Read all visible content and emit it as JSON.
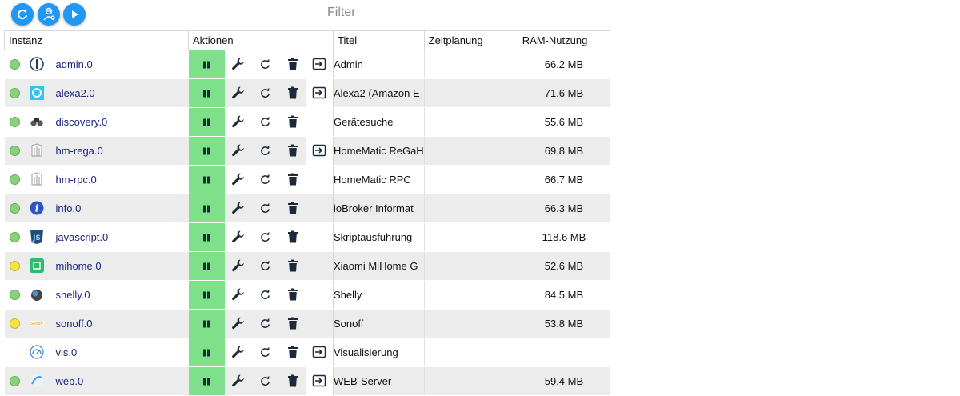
{
  "toolbar": {
    "filter_placeholder": "Filter",
    "button_color": "#2196f3"
  },
  "table": {
    "headers": {
      "instance": "Instanz",
      "actions": "Aktionen",
      "title": "Titel",
      "schedule": "Zeitplanung",
      "ram": "RAM-Nutzung"
    },
    "colors": {
      "status_green": "#8ad17a",
      "status_yellow": "#f5e24a",
      "pause_bg": "#7ee08a",
      "name_link": "#1a237e",
      "action_icon": "#1e2a3a"
    },
    "rows": [
      {
        "status": "green",
        "icon": "admin-icon",
        "name": "admin.0",
        "title": "Admin",
        "ram": "66.2 MB",
        "link": true
      },
      {
        "status": "green",
        "icon": "alexa-icon",
        "name": "alexa2.0",
        "title": "Alexa2 (Amazon E",
        "ram": "71.6 MB",
        "link": true
      },
      {
        "status": "green",
        "icon": "binoculars-icon",
        "name": "discovery.0",
        "title": "Gerätesuche",
        "ram": "55.6 MB",
        "link": false
      },
      {
        "status": "green",
        "icon": "homematic-icon",
        "name": "hm-rega.0",
        "title": "HomeMatic ReGaH",
        "ram": "69.8 MB",
        "link": true
      },
      {
        "status": "green",
        "icon": "homematic-icon",
        "name": "hm-rpc.0",
        "title": "HomeMatic RPC",
        "ram": "66.7 MB",
        "link": false
      },
      {
        "status": "green",
        "icon": "info-icon",
        "name": "info.0",
        "title": "ioBroker Informat",
        "ram": "66.3 MB",
        "link": false
      },
      {
        "status": "green",
        "icon": "javascript-icon",
        "name": "javascript.0",
        "title": "Skriptausführung",
        "ram": "118.6 MB",
        "link": false
      },
      {
        "status": "yellow",
        "icon": "mihome-icon",
        "name": "mihome.0",
        "title": "Xiaomi MiHome G",
        "ram": "52.6 MB",
        "link": false
      },
      {
        "status": "green",
        "icon": "shelly-icon",
        "name": "shelly.0",
        "title": "Shelly",
        "ram": "84.5 MB",
        "link": false
      },
      {
        "status": "yellow",
        "icon": "sonoff-icon",
        "name": "sonoff.0",
        "title": "Sonoff",
        "ram": "53.8 MB",
        "link": false
      },
      {
        "status": "none",
        "icon": "vis-icon",
        "name": "vis.0",
        "title": "Visualisierung",
        "ram": "",
        "link": true
      },
      {
        "status": "green",
        "icon": "web-icon",
        "name": "web.0",
        "title": "WEB-Server",
        "ram": "59.4 MB",
        "link": true
      }
    ]
  }
}
